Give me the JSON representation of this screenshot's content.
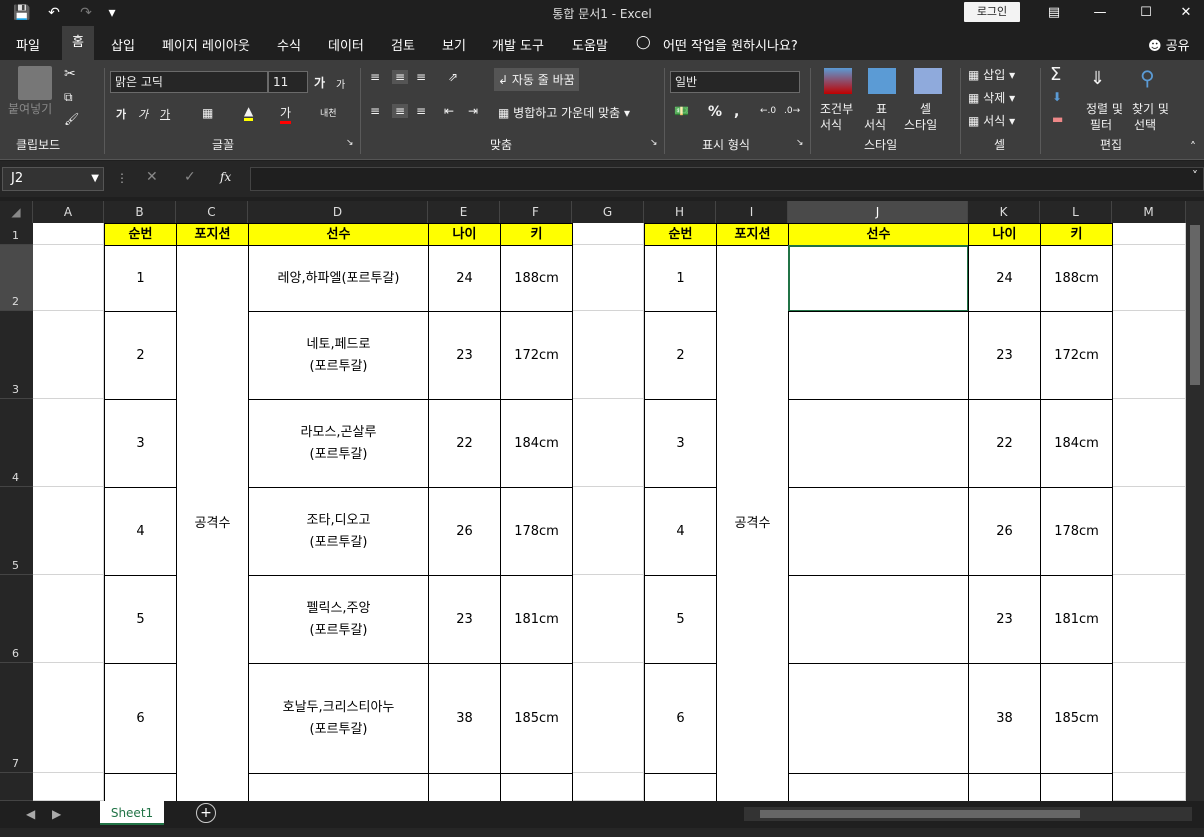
{
  "titlebar": {
    "title": "통합 문서1 - Excel",
    "login": "로그인",
    "save_icon": "save-icon",
    "undo_icon": "undo-icon",
    "redo_icon": "redo-icon"
  },
  "tabs": [
    "파일",
    "홈",
    "삽입",
    "페이지 레이아웃",
    "수식",
    "데이터",
    "검토",
    "보기",
    "개발 도구",
    "도움말"
  ],
  "tell_me": "어떤 작업을 원하시나요?",
  "share": "공유",
  "ribbon": {
    "clipboard": {
      "paste": "붙여넣기",
      "label": "클립보드"
    },
    "font": {
      "name": "맑은 고딕",
      "size": "11",
      "label": "글꼴",
      "grow": "가",
      "shrink": "가",
      "bold": "가",
      "italic": "가",
      "underline": "가",
      "phonetic": "내천"
    },
    "align": {
      "wrap": "자동 줄 바꿈",
      "merge": "병합하고 가운데 맞춤",
      "label": "맞춤"
    },
    "number": {
      "format": "일반",
      "label": "표시 형식",
      "percent": "%",
      "comma": ","
    },
    "styles": {
      "cond": "조건부",
      "cond2": "서식",
      "table": "표",
      "table2": "서식",
      "cell": "셀",
      "cell2": "스타일",
      "label": "스타일"
    },
    "cells": {
      "insert": "삽입",
      "delete": "삭제",
      "format": "서식",
      "label": "셀"
    },
    "editing": {
      "sort": "정렬 및",
      "sort2": "필터",
      "find": "찾기 및",
      "find2": "선택",
      "label": "편집"
    }
  },
  "formula_bar": {
    "name_box": "J2",
    "fx": "fx",
    "value": ""
  },
  "columns": [
    "A",
    "B",
    "C",
    "D",
    "E",
    "F",
    "G",
    "H",
    "I",
    "J",
    "K",
    "L",
    "M"
  ],
  "rows": [
    "1",
    "2",
    "3",
    "4",
    "5",
    "6",
    "7"
  ],
  "left_table": {
    "headers": [
      "순번",
      "포지션",
      "선수",
      "나이",
      "키"
    ],
    "position": "공격수",
    "rows": [
      {
        "no": "1",
        "player1": "레앙,하파엘(포르투갈)",
        "player2": "",
        "age": "24",
        "height": "188cm"
      },
      {
        "no": "2",
        "player1": "네토,페드로",
        "player2": "(포르투갈)",
        "age": "23",
        "height": "172cm"
      },
      {
        "no": "3",
        "player1": "라모스,곤살루",
        "player2": "(포르투갈)",
        "age": "22",
        "height": "184cm"
      },
      {
        "no": "4",
        "player1": "조타,디오고",
        "player2": "(포르투갈)",
        "age": "26",
        "height": "178cm"
      },
      {
        "no": "5",
        "player1": "펠릭스,주앙",
        "player2": "(포르투갈)",
        "age": "23",
        "height": "181cm"
      },
      {
        "no": "6",
        "player1": "호날두,크리스티아누",
        "player2": "(포르투갈)",
        "age": "38",
        "height": "185cm"
      }
    ]
  },
  "right_table": {
    "headers": [
      "순번",
      "포지션",
      "선수",
      "나이",
      "키"
    ],
    "position": "공격수",
    "rows": [
      {
        "no": "1",
        "age": "24",
        "height": "188cm"
      },
      {
        "no": "2",
        "age": "23",
        "height": "172cm"
      },
      {
        "no": "3",
        "age": "22",
        "height": "184cm"
      },
      {
        "no": "4",
        "age": "26",
        "height": "178cm"
      },
      {
        "no": "5",
        "age": "23",
        "height": "181cm"
      },
      {
        "no": "6",
        "age": "38",
        "height": "185cm"
      }
    ]
  },
  "sheet": {
    "tab": "Sheet1",
    "add": "+"
  }
}
